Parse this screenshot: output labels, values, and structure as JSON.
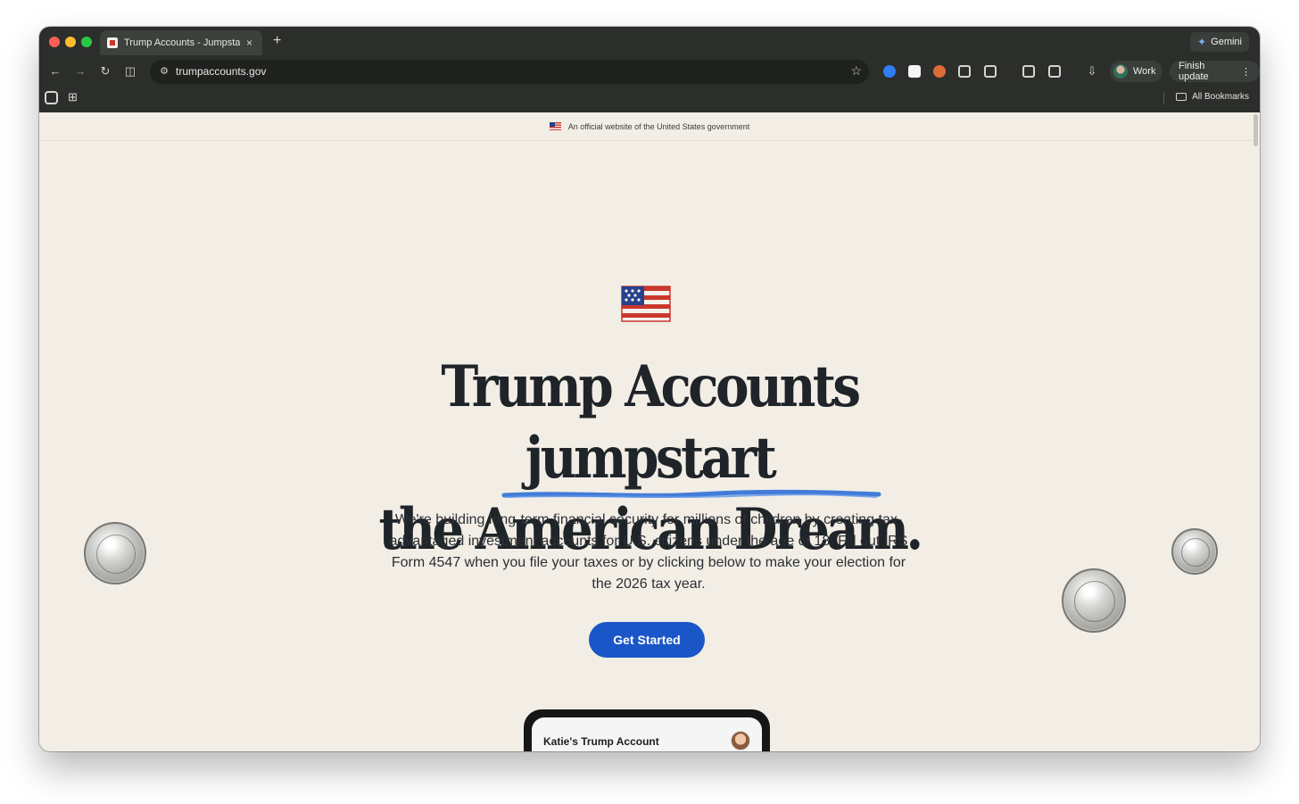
{
  "browser": {
    "tab_title": "Trump Accounts - Jumpstarti",
    "close_icon": "×",
    "new_tab_icon": "+",
    "gemini_label": "Gemini",
    "gemini_icon": "✦",
    "back_icon": "←",
    "forward_icon": "→",
    "reload_icon": "↻",
    "split_icon": "◫",
    "tune_icon": "⚙",
    "url": "trumpaccounts.gov",
    "star_icon": "☆",
    "download_icon": "⇩",
    "profile_label": "Work",
    "finish_update_label": "Finish update",
    "menu_icon": "⋮",
    "tabs_icon": "⊞",
    "all_bookmarks_label": "All Bookmarks"
  },
  "page": {
    "official_notice": "An official website of the United States government",
    "headline_line1": "Trump Accounts jumpstart",
    "headline_line2": "the American Dream.",
    "lead": "We're building long-term financial security for millions of children by creating tax-advantaged investment accounts for U.S. citizens under the age of 18. Fill out IRS Form 4547 when you file your taxes or by clicking below to make your election for the 2026 tax year.",
    "cta_label": "Get Started",
    "phone_card_title": "Katie's Trump Account"
  },
  "colors": {
    "page_background": "#f2eee6",
    "browser_chrome": "#2b2e2b",
    "primary_button": "#1a56c7",
    "flag_red": "#c9372c",
    "flag_blue": "#27418c",
    "underline_blue": "#2f6fd6"
  }
}
